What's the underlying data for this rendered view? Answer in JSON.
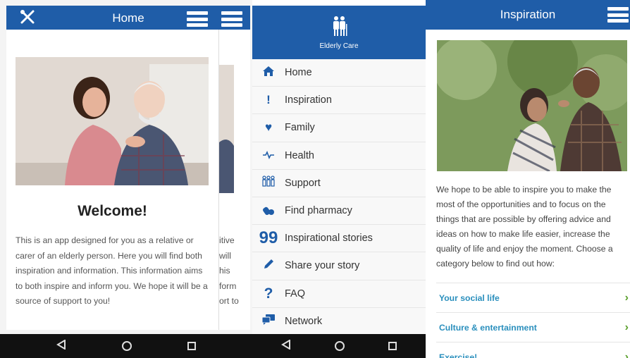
{
  "home_screen": {
    "title": "Home",
    "icons": {
      "tools": "tools-icon",
      "menu": "hamburger-menu-icon"
    },
    "welcome_heading": "Welcome!",
    "intro_text": "This is an app designed for you as a relative or carer of an elderly person. Here you will find both inspiration and information. This information aims to both inspire and inform you. We hope it will be a source of support to you!",
    "peek_text_lines": [
      "itive",
      "will",
      "his",
      "form",
      "ort to"
    ]
  },
  "drawer": {
    "brand": "Elderly Care",
    "items": [
      {
        "label": "Home",
        "icon": "home-icon",
        "glyph": "⌂"
      },
      {
        "label": "Inspiration",
        "icon": "exclamation-icon",
        "glyph": "!"
      },
      {
        "label": "Family",
        "icon": "heart-icon",
        "glyph": "♥"
      },
      {
        "label": "Health",
        "icon": "pulse-icon",
        "glyph": "〰"
      },
      {
        "label": "Support",
        "icon": "people-icon",
        "glyph": "☷"
      },
      {
        "label": "Find pharmacy",
        "icon": "pharmacy-icon",
        "glyph": "✚"
      },
      {
        "label": "Inspirational stories",
        "icon": "quote-icon",
        "glyph": "❞"
      },
      {
        "label": "Share your story",
        "icon": "pencil-icon",
        "glyph": "✎"
      },
      {
        "label": "FAQ",
        "icon": "question-icon",
        "glyph": "?"
      },
      {
        "label": "Network",
        "icon": "chat-icon",
        "glyph": "✉"
      }
    ]
  },
  "inspiration_screen": {
    "title": "Inspiration",
    "body_text": "We hope to be able to inspire you to make the most of the opportunities and to focus on the things that are possible by offering advice and ideas on how to make life easier, increase the quality of life and enjoy the moment. Choose a category below to find out how:",
    "categories": [
      {
        "label": "Your social life"
      },
      {
        "label": "Culture & entertainment"
      },
      {
        "label": "Exercise!"
      }
    ]
  },
  "nav_bar": {
    "icons": [
      "back-icon",
      "home-circle-icon",
      "recent-apps-icon"
    ]
  },
  "colors": {
    "primary": "#1f5da8",
    "link": "#2a8fbd",
    "chevron": "#5aa02c"
  }
}
